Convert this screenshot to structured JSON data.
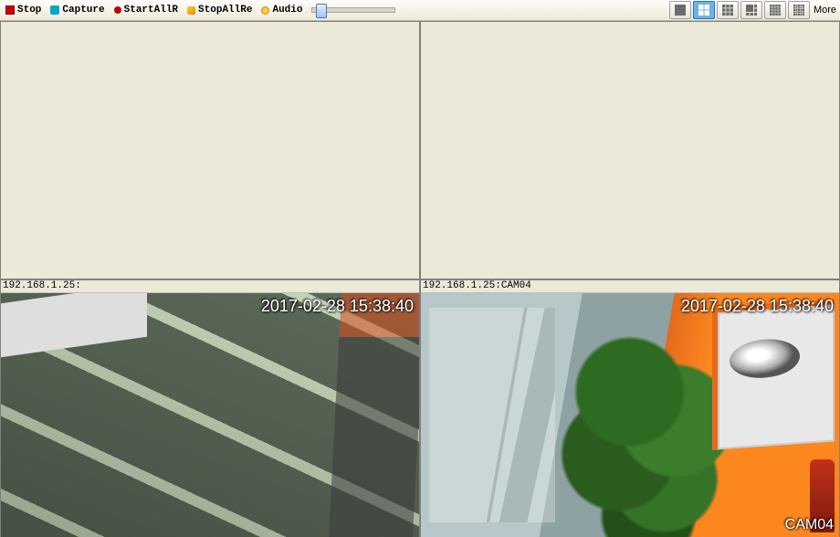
{
  "toolbar": {
    "stop": "Stop",
    "capture": "Capture",
    "start_all_rec": "StartAllR",
    "stop_all_rec": "StopAllRe",
    "audio": "Audio",
    "more": "More"
  },
  "layout_buttons": [
    {
      "name": "layout-1x1",
      "active": false
    },
    {
      "name": "layout-2x2",
      "active": true
    },
    {
      "name": "layout-3x3",
      "active": false
    },
    {
      "name": "layout-4x4-a",
      "active": false
    },
    {
      "name": "layout-4x4-b",
      "active": false
    },
    {
      "name": "layout-5x5",
      "active": false
    }
  ],
  "cells": [
    {
      "label": "",
      "has_video": false
    },
    {
      "label": "",
      "has_video": false
    },
    {
      "label": "192.168.1.25:",
      "has_video": true,
      "timestamp": "2017-02-28 15:38:40",
      "cam_name": ""
    },
    {
      "label": "192.168.1.25:CAM04",
      "has_video": true,
      "timestamp": "2017-02-28 15:38:40",
      "cam_name": "CAM04"
    }
  ],
  "volume_slider": {
    "value": 5,
    "min": 0,
    "max": 100
  }
}
